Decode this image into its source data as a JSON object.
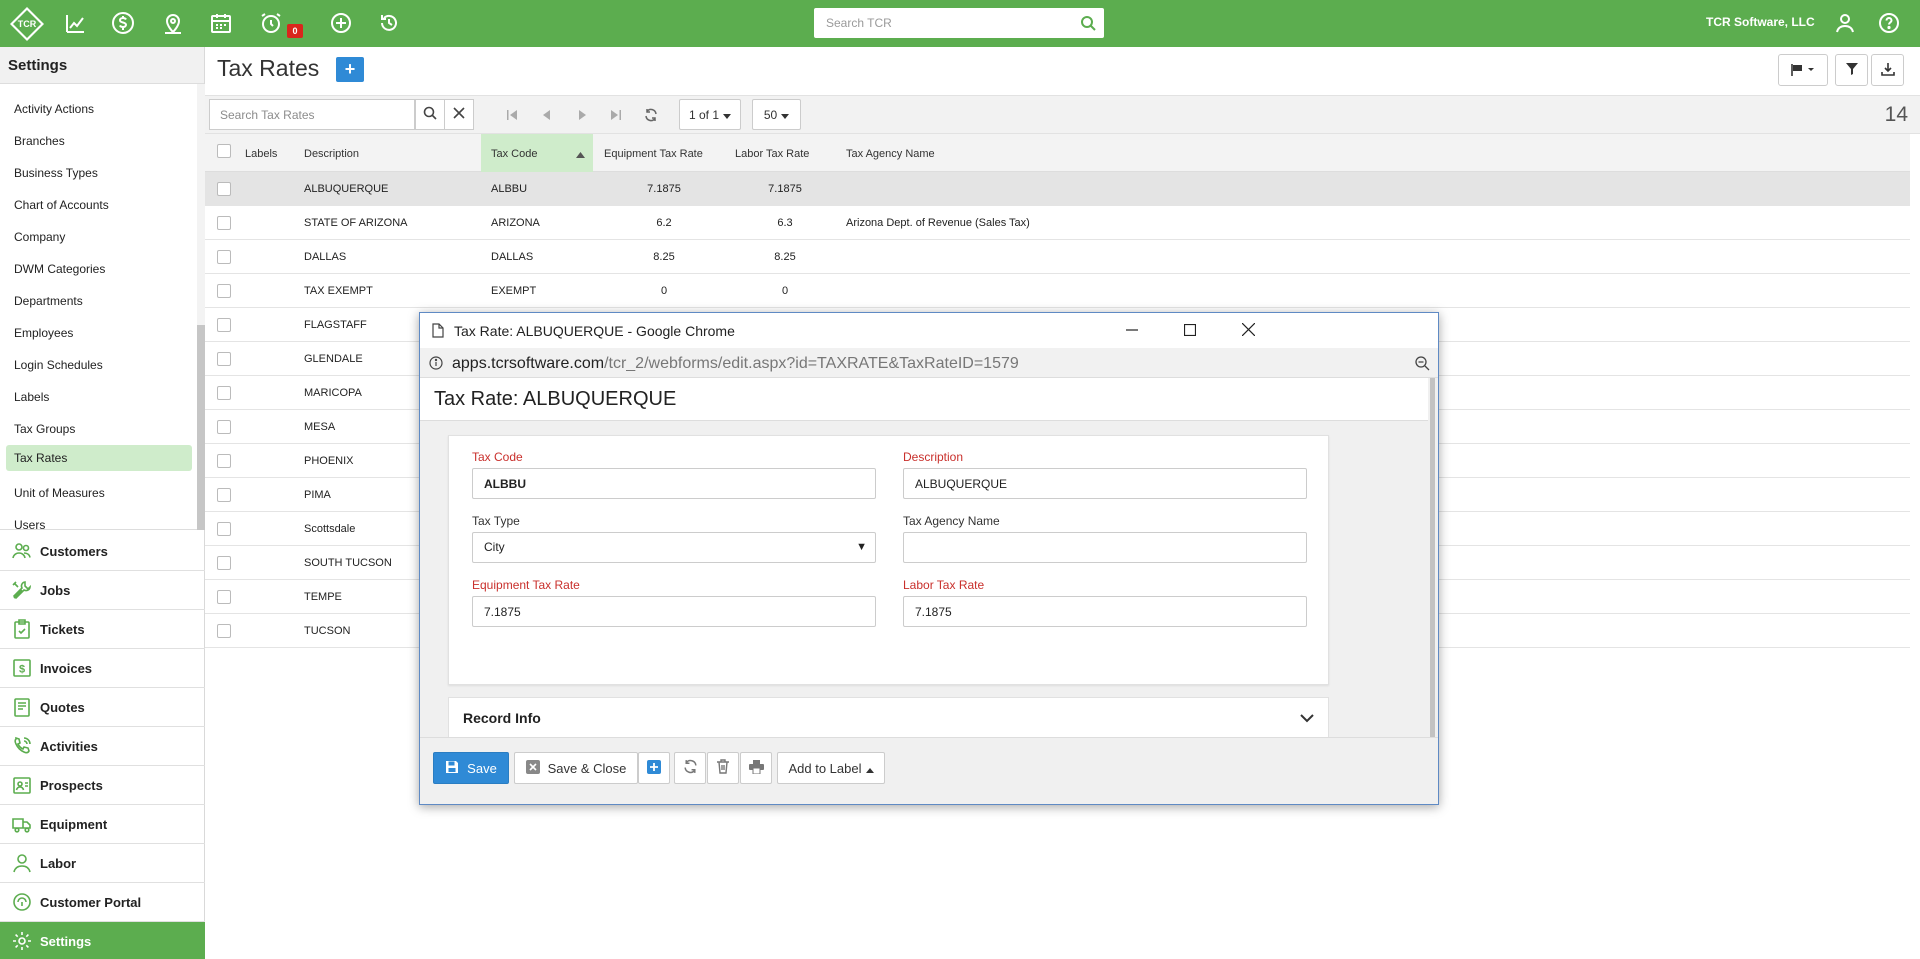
{
  "app": {
    "logo_text": "TCR",
    "search_placeholder": "Search TCR",
    "company": "TCR Software, LLC",
    "notifications_count": "0"
  },
  "sidebar": {
    "title": "Settings",
    "settings_items": [
      {
        "label": "Activity Actions"
      },
      {
        "label": "Branches"
      },
      {
        "label": "Business Types"
      },
      {
        "label": "Chart of Accounts"
      },
      {
        "label": "Company"
      },
      {
        "label": "DWM Categories"
      },
      {
        "label": "Departments"
      },
      {
        "label": "Employees"
      },
      {
        "label": "Login Schedules"
      },
      {
        "label": "Labels"
      },
      {
        "label": "Tax Groups"
      },
      {
        "label": "Tax Rates",
        "active": true
      },
      {
        "label": "Unit of Measures"
      },
      {
        "label": "Users"
      }
    ],
    "nav": [
      {
        "label": "Customers",
        "icon": "users-icon"
      },
      {
        "label": "Jobs",
        "icon": "tools-icon"
      },
      {
        "label": "Tickets",
        "icon": "ticket-icon"
      },
      {
        "label": "Invoices",
        "icon": "invoice-icon"
      },
      {
        "label": "Quotes",
        "icon": "quote-icon"
      },
      {
        "label": "Activities",
        "icon": "phone-icon"
      },
      {
        "label": "Prospects",
        "icon": "prospects-icon"
      },
      {
        "label": "Equipment",
        "icon": "truck-icon"
      },
      {
        "label": "Labor",
        "icon": "person-icon"
      },
      {
        "label": "Customer Portal",
        "icon": "portal-icon"
      },
      {
        "label": "Settings",
        "icon": "gear-icon",
        "active": true
      }
    ]
  },
  "main": {
    "title": "Tax Rates",
    "search_placeholder": "Search Tax Rates",
    "page_display": "1 of 1",
    "page_size": "50",
    "record_count": "14",
    "columns": {
      "labels": "Labels",
      "description": "Description",
      "tax_code": "Tax Code",
      "equipment_rate": "Equipment Tax Rate",
      "labor_rate": "Labor Tax Rate",
      "agency": "Tax Agency Name"
    },
    "rows": [
      {
        "description": "ALBUQUERQUE",
        "code": "ALBBU",
        "equip": "7.1875",
        "labor": "7.1875",
        "agency": ""
      },
      {
        "description": "STATE OF ARIZONA",
        "code": "ARIZONA",
        "equip": "6.2",
        "labor": "6.3",
        "agency": "Arizona Dept. of Revenue (Sales Tax)"
      },
      {
        "description": "DALLAS",
        "code": "DALLAS",
        "equip": "8.25",
        "labor": "8.25",
        "agency": ""
      },
      {
        "description": "TAX EXEMPT",
        "code": "EXEMPT",
        "equip": "0",
        "labor": "0",
        "agency": ""
      },
      {
        "description": "FLAGSTAFF",
        "code": "",
        "equip": "",
        "labor": "",
        "agency": ""
      },
      {
        "description": "GLENDALE",
        "code": "",
        "equip": "",
        "labor": "",
        "agency": ""
      },
      {
        "description": "MARICOPA",
        "code": "",
        "equip": "",
        "labor": "",
        "agency": ""
      },
      {
        "description": "MESA",
        "code": "",
        "equip": "",
        "labor": "",
        "agency": ""
      },
      {
        "description": "PHOENIX",
        "code": "",
        "equip": "",
        "labor": "",
        "agency": ""
      },
      {
        "description": "PIMA",
        "code": "",
        "equip": "",
        "labor": "",
        "agency": ""
      },
      {
        "description": "Scottsdale",
        "code": "",
        "equip": "",
        "labor": "",
        "agency": ""
      },
      {
        "description": "SOUTH TUCSON",
        "code": "",
        "equip": "",
        "labor": "",
        "agency": ""
      },
      {
        "description": "TEMPE",
        "code": "",
        "equip": "",
        "labor": "",
        "agency": ""
      },
      {
        "description": "TUCSON",
        "code": "",
        "equip": "",
        "labor": "",
        "agency": ""
      }
    ]
  },
  "popup": {
    "window_title": "Tax Rate: ALBUQUERQUE - Google Chrome",
    "url_host": "apps.tcrsoftware.com",
    "url_path": "/tcr_2/webforms/edit.aspx?id=TAXRATE&TaxRateID=1579",
    "heading": "Tax Rate: ALBUQUERQUE",
    "fields": {
      "tax_code_label": "Tax Code",
      "tax_code_value": "ALBBU",
      "description_label": "Description",
      "description_value": "ALBUQUERQUE",
      "tax_type_label": "Tax Type",
      "tax_type_value": "City",
      "agency_label": "Tax Agency Name",
      "agency_value": "",
      "equip_label": "Equipment Tax Rate",
      "equip_value": "7.1875",
      "labor_label": "Labor Tax Rate",
      "labor_value": "7.1875"
    },
    "record_info": "Record Info",
    "buttons": {
      "save": "Save",
      "save_close": "Save & Close",
      "add_to_label": "Add to Label"
    }
  },
  "colors": {
    "brand_green": "#5cad4f",
    "active_light_green": "#cfeccb",
    "primary_blue": "#2f8ad6",
    "required_red": "#c9302c"
  }
}
